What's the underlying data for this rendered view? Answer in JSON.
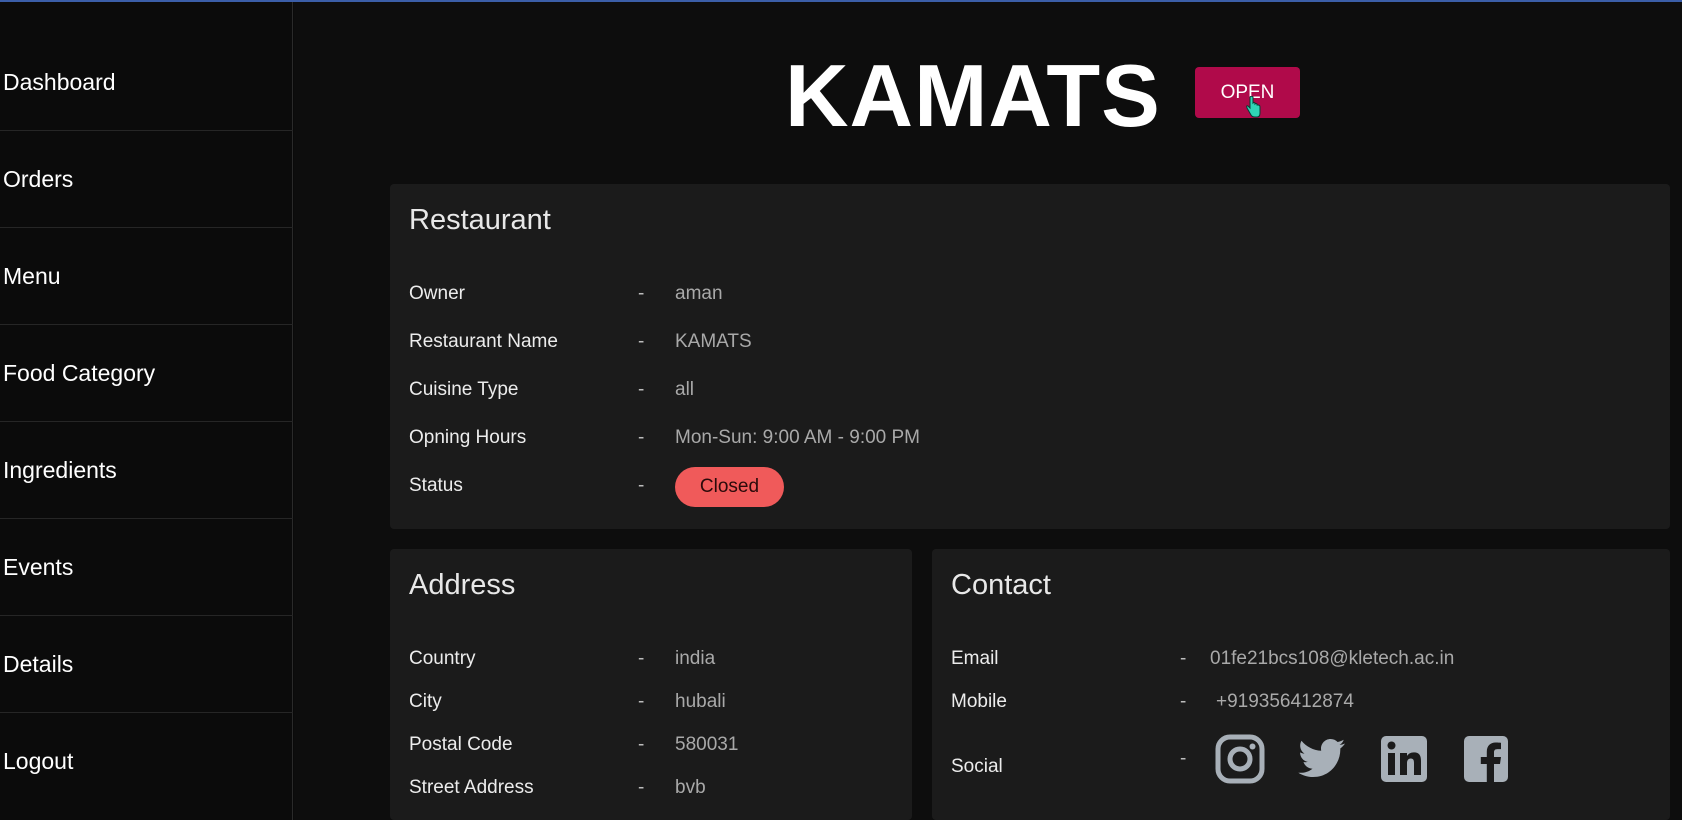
{
  "sidebar": {
    "items": [
      {
        "label": "Dashboard"
      },
      {
        "label": "Orders"
      },
      {
        "label": "Menu"
      },
      {
        "label": "Food Category"
      },
      {
        "label": "Ingredients"
      },
      {
        "label": "Events"
      },
      {
        "label": "Details"
      },
      {
        "label": "Logout"
      }
    ]
  },
  "header": {
    "title": "KAMATS",
    "open_button": "OPEN"
  },
  "restaurant": {
    "heading": "Restaurant",
    "rows": [
      {
        "label": "Owner",
        "sep": "-",
        "value": "aman"
      },
      {
        "label": "Restaurant Name",
        "sep": "-",
        "value": "KAMATS"
      },
      {
        "label": "Cuisine Type",
        "sep": "-",
        "value": "all"
      },
      {
        "label": "Opning Hours",
        "sep": "-",
        "value": "Mon-Sun: 9:00 AM - 9:00 PM"
      }
    ],
    "status_label": "Status",
    "status_sep": "-",
    "status_value": "Closed",
    "status_color": "#f05a5a"
  },
  "address": {
    "heading": "Address",
    "rows": [
      {
        "label": "Country",
        "sep": "-",
        "value": "india"
      },
      {
        "label": "City",
        "sep": "-",
        "value": "hubali"
      },
      {
        "label": "Postal Code",
        "sep": "-",
        "value": "580031"
      },
      {
        "label": "Street Address",
        "sep": "-",
        "value": "bvb"
      }
    ]
  },
  "contact": {
    "heading": "Contact",
    "rows": [
      {
        "label": "Email",
        "sep": "-",
        "value": "01fe21bcs108@kletech.ac.in"
      },
      {
        "label": "Mobile",
        "sep": "-",
        "value": "+919356412874"
      }
    ],
    "social_label": "Social",
    "social_sep": "-",
    "social_icons": [
      "instagram-icon",
      "twitter-icon",
      "linkedin-icon",
      "facebook-icon"
    ]
  },
  "colors": {
    "accent": "#b00a4a",
    "status_closed": "#f05a5a",
    "card_bg": "#1b1b1b",
    "page_bg": "#0d0d0d"
  }
}
